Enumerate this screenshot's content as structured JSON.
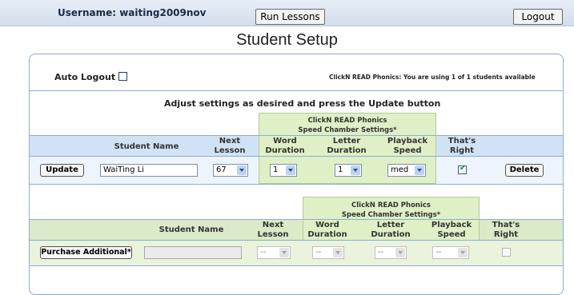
{
  "topbar": {
    "username_label": "Username: waiting2009nov",
    "run_lessons_label": "Run Lessons",
    "logout_label": "Logout"
  },
  "page_title": "Student Setup",
  "panel": {
    "auto_logout_label": "Auto Logout",
    "auto_logout_checked": false,
    "usage_status": "ClickN READ Phonics:  You are using 1 of 1 students available",
    "instructions": "Adjust settings as desired and press the Update button"
  },
  "speed_chamber": {
    "title_line1": "ClickN READ Phonics",
    "title_line2": "Speed Chamber Settings*"
  },
  "columns": {
    "student_name": "Student Name",
    "next_lesson": [
      "Next",
      "Lesson"
    ],
    "word_duration": [
      "Word",
      "Duration"
    ],
    "letter_duration": [
      "Letter",
      "Duration"
    ],
    "playback_speed": [
      "Playback",
      "Speed"
    ],
    "thats_right": [
      "That's",
      "Right"
    ]
  },
  "student_row": {
    "update_label": "Update",
    "student_name": "WaiTing Li",
    "next_lesson": "67",
    "word_duration": "1",
    "letter_duration": "1",
    "playback_speed": "med",
    "thats_right_checked": true,
    "delete_label": "Delete"
  },
  "purchase_row": {
    "purchase_label": "Purchase Additional*",
    "student_name": "",
    "next_lesson": "--",
    "word_duration": "--",
    "letter_duration": "--",
    "playback_speed": "--",
    "thats_right_checked": false
  }
}
